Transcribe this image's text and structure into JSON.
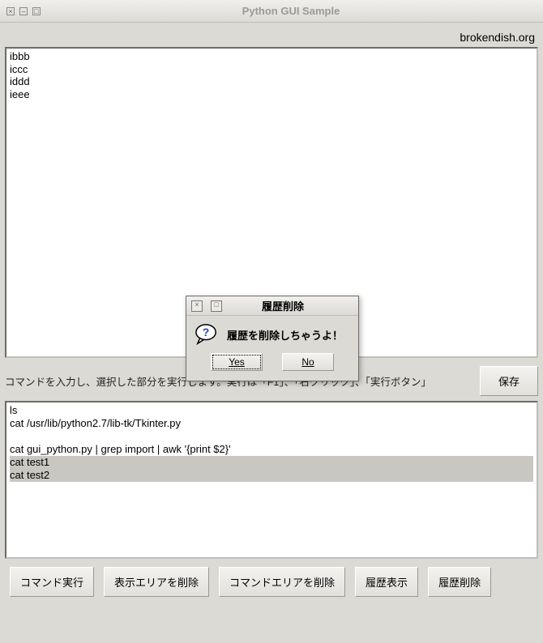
{
  "window": {
    "title": "Python GUI Sample",
    "close_glyph": "×",
    "min_glyph": "–",
    "max_glyph": "□"
  },
  "branding": "brokendish.org",
  "output_lines": [
    "ibbb",
    "iccc",
    "iddd",
    "ieee"
  ],
  "hint": "コマンドを入力し、選択した部分を実行します。実行は「F1」、「右クリック」、「実行ボタン」",
  "save_label": "保存",
  "cmd_lines": [
    {
      "text": "ls",
      "selected": false
    },
    {
      "text": "cat /usr/lib/python2.7/lib-tk/Tkinter.py",
      "selected": false
    },
    {
      "text": "",
      "selected": false,
      "spacer": true
    },
    {
      "text": "cat gui_python.py | grep import | awk '{print $2}'",
      "selected": false
    },
    {
      "text": "cat test1",
      "selected": true
    },
    {
      "text": "cat test2",
      "selected": true
    }
  ],
  "buttons": {
    "run": "コマンド実行",
    "clear_display": "表示エリアを削除",
    "clear_cmd": "コマンドエリアを削除",
    "show_history": "履歴表示",
    "delete_history": "履歴削除"
  },
  "dialog": {
    "title": "履歴削除",
    "message": "履歴を削除しちゃうよ！",
    "yes_label": "Yes",
    "no_label": "No",
    "close_glyph": "×",
    "max_glyph": "□"
  }
}
